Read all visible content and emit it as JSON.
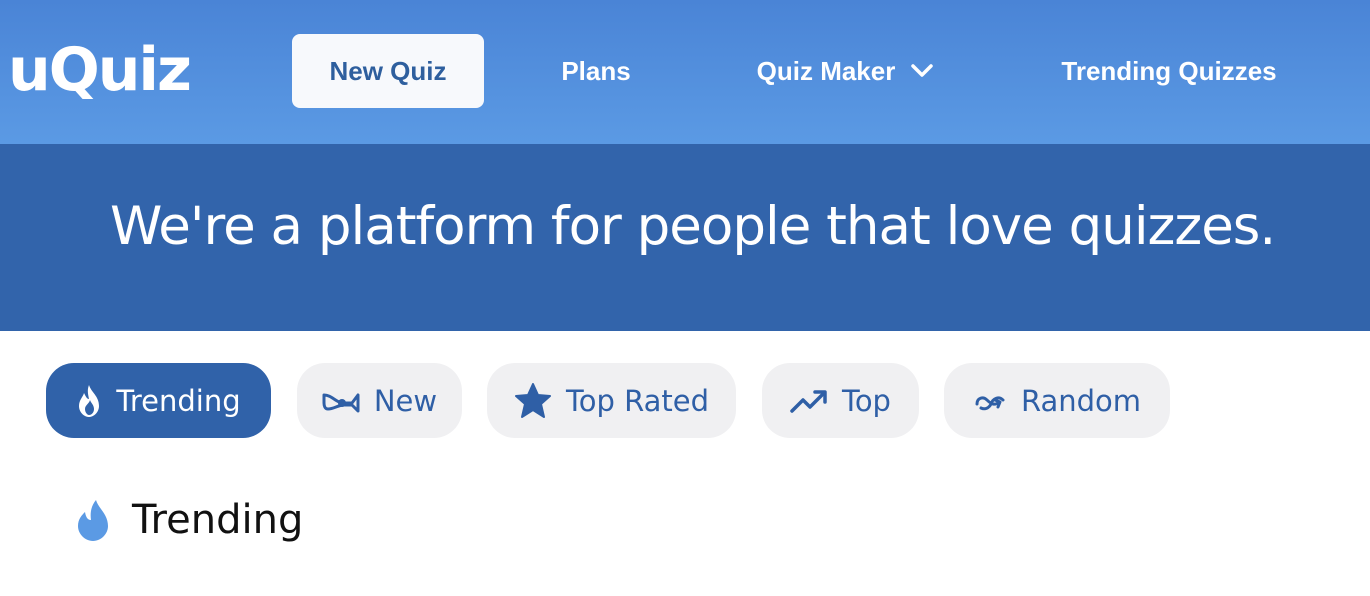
{
  "header": {
    "logo_text": "uQuiz",
    "nav": [
      {
        "label": "New Quiz"
      },
      {
        "label": "Plans"
      },
      {
        "label": "Quiz Maker"
      },
      {
        "label": "Trending Quizzes"
      }
    ]
  },
  "hero": {
    "headline": "We're a platform for people that love quizzes."
  },
  "filters": [
    {
      "label": "Trending",
      "icon": "flame-icon",
      "active": true
    },
    {
      "label": "New",
      "icon": "horn-icon",
      "active": false
    },
    {
      "label": "Top Rated",
      "icon": "star-icon",
      "active": false
    },
    {
      "label": "Top",
      "icon": "trending-up-icon",
      "active": false
    },
    {
      "label": "Random",
      "icon": "shuffle-icon",
      "active": false
    }
  ],
  "section": {
    "title": "Trending",
    "icon": "flame-icon"
  },
  "colors": {
    "nav_bg": "#5b9ae4",
    "hero_bg": "#3264ab",
    "pill_active": "#3062a9",
    "pill_bg": "#f0f0f2",
    "accent_text": "#2f5fa6"
  }
}
